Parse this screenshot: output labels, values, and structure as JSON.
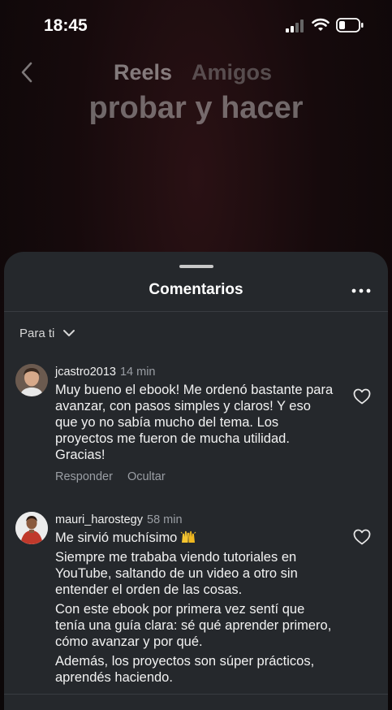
{
  "status_bar": {
    "time": "18:45",
    "icons": [
      "signal-icon",
      "wifi-icon",
      "battery-icon"
    ]
  },
  "reels_header": {
    "tabs": [
      {
        "label": "Reels"
      },
      {
        "label": "Amigos"
      }
    ],
    "caption": "probar y hacer",
    "icons": [
      "back-icon"
    ]
  },
  "sheet": {
    "title": "Comentarios",
    "sort_label": "Para ti",
    "icons": [
      "more-icon",
      "chevron-down-icon"
    ]
  },
  "comments": [
    {
      "username": "jcastro2013",
      "time": "14 min",
      "paragraphs": [
        "Muy bueno el ebook! Me ordenó bastante para avanzar, con pasos simples y claros! Y eso que yo no sabía mucho del tema. Los proyectos me fueron de mucha utilidad. Gracias!"
      ],
      "reply_label": "Responder",
      "hide_label": "Ocultar"
    },
    {
      "username": "mauri_harostegy",
      "time": "58 min",
      "paragraphs": [
        "Me sirvió muchísimo",
        "Siempre me trababa viendo tutoriales en YouTube, saltando de un video a otro sin entender el orden de las cosas.",
        "Con este ebook por primera vez sentí que tenía una guía clara: sé qué aprender primero, cómo avanzar y por qué.",
        "Además, los proyectos son súper prácticos, aprendés haciendo."
      ],
      "emoji": "raised-hands-emoji"
    }
  ],
  "colors": {
    "sheet_bg": "#25282c",
    "secondary_text": "#9a9ea4",
    "primary_text": "#f2f2f2"
  }
}
